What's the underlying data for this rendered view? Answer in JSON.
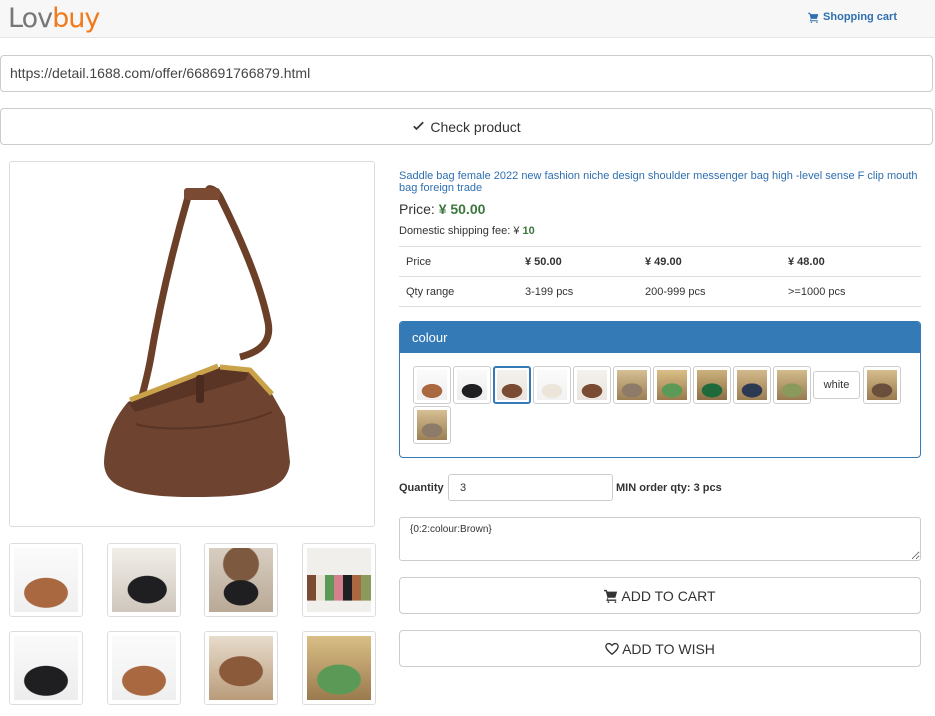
{
  "header": {
    "logo_part1": "Lov",
    "logo_part2": "buy",
    "cart_label": "Shopping cart"
  },
  "search": {
    "url_value": "https://detail.1688.com/offer/668691766879.html",
    "check_button": "Check product"
  },
  "product": {
    "title": "Saddle bag female 2022 new fashion niche design shoulder messenger bag high -level sense F clip mouth bag foreign trade",
    "price_label": "Price:",
    "price_value": "¥ 50.00",
    "shipping_label": "Domestic shipping fee:",
    "shipping_currency": "¥",
    "shipping_value": "10",
    "price_table": {
      "row_price_label": "Price",
      "row_qty_label": "Qty range",
      "tiers": [
        {
          "price": "¥ 50.00",
          "range": "3-199 pcs"
        },
        {
          "price": "¥ 49.00",
          "range": "200-999 pcs"
        },
        {
          "price": "¥ 48.00",
          "range": ">=1000 pcs"
        }
      ]
    }
  },
  "colour": {
    "heading": "colour",
    "white_option": "white",
    "selected_index": 2
  },
  "order": {
    "quantity_label": "Quantity",
    "quantity_value": "3",
    "min_order": "MIN order qty: 3 pcs",
    "notes_value": "{0:2:colour:Brown}",
    "add_to_cart": "ADD TO CART",
    "add_to_wish": "ADD TO WISH"
  },
  "icons": {
    "cart": "cart-icon",
    "check": "check-icon",
    "heart": "heart-outline-icon"
  },
  "colors": {
    "brand_gray": "#777777",
    "brand_orange": "#f07a1c",
    "link_blue": "#2f6fb0",
    "panel_blue": "#337ab7",
    "price_green": "#3c763d"
  }
}
